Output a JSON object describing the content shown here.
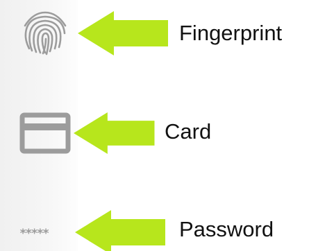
{
  "options": {
    "fingerprint": {
      "label": "Fingerprint",
      "icon": "fingerprint-icon"
    },
    "card": {
      "label": "Card",
      "icon": "card-icon"
    },
    "password": {
      "label": "Password",
      "icon": "password-icon",
      "mask": "*****"
    }
  },
  "colors": {
    "arrow": "#b7e61c",
    "icon": "#9c9c9c",
    "text": "#111111",
    "sidebar": "#f3f3f3"
  }
}
